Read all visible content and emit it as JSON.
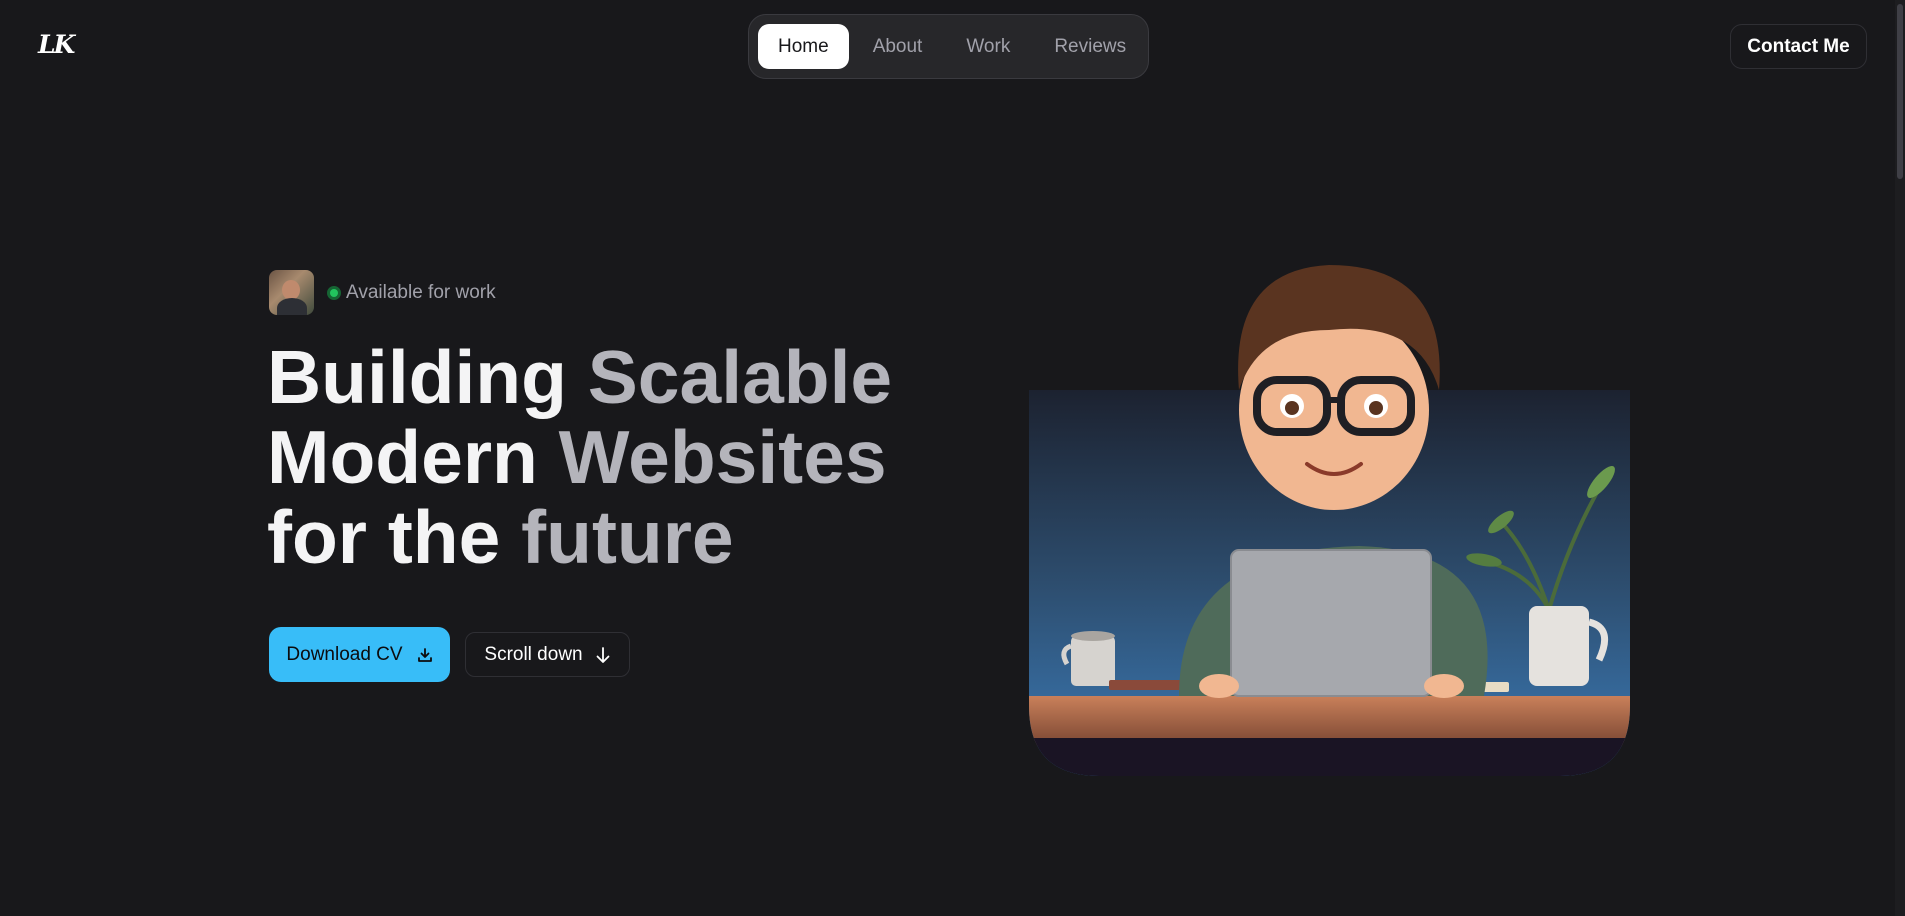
{
  "brand": {
    "logo_text": "LK"
  },
  "nav": {
    "items": [
      {
        "label": "Home",
        "active": true
      },
      {
        "label": "About",
        "active": false
      },
      {
        "label": "Work",
        "active": false
      },
      {
        "label": "Reviews",
        "active": false
      }
    ]
  },
  "header": {
    "contact_label": "Contact Me"
  },
  "hero": {
    "status_text": "Available for work",
    "headline": {
      "line1_a": "Building",
      "line1_b": "Scalable",
      "line2_a": "Modern",
      "line2_b": "Websites",
      "line3_a": "for the",
      "line3_b": "future"
    },
    "download_label": "Download CV",
    "scroll_label": "Scroll down",
    "illustration": "cartoon-developer-at-laptop"
  },
  "colors": {
    "background": "#18181b",
    "accent": "#38bdf8",
    "status_green": "#22c55e"
  }
}
